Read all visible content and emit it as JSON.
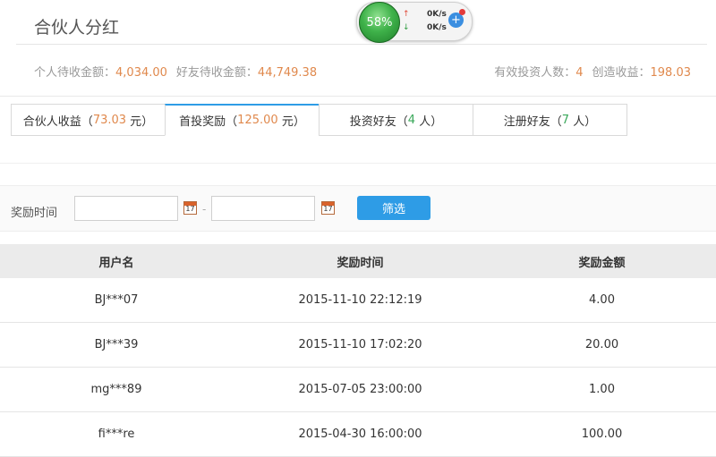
{
  "page": {
    "title": "合伙人分红"
  },
  "summary": {
    "pending_label": "个人待收金额：",
    "pending_value": "4,034.00",
    "friends_pending_label": "好友待收金额：",
    "friends_pending_value": "44,749.38",
    "investors_label": "有效投资人数：",
    "investors_value": "4",
    "created_label": "创造收益：",
    "created_value": "198.03"
  },
  "tabs": [
    {
      "label": "合伙人收益",
      "open": "（",
      "value": "73.03",
      "unit": "元",
      "close": "）"
    },
    {
      "label": "首投奖励",
      "open": "（",
      "value": "125.00",
      "unit": "元",
      "close": "）"
    },
    {
      "label": "投资好友",
      "open": "（",
      "value": "4",
      "unit": "人",
      "close": "）"
    },
    {
      "label": "注册好友",
      "open": "（",
      "value": "7",
      "unit": "人",
      "close": "）"
    }
  ],
  "filter": {
    "label": "奖励时间",
    "separator": "-",
    "button": "筛选",
    "start_value": "",
    "end_value": "",
    "calendar_glyph": "17"
  },
  "table": {
    "headers": [
      "用户名",
      "奖励时间",
      "奖励金额"
    ],
    "rows": [
      [
        "BJ***07",
        "2015-11-10 22:12:19",
        "4.00"
      ],
      [
        "BJ***39",
        "2015-11-10 17:02:20",
        "20.00"
      ],
      [
        "mg***89",
        "2015-07-05 23:00:00",
        "1.00"
      ],
      [
        "fi***re",
        "2015-04-30 16:00:00",
        "100.00"
      ]
    ]
  },
  "widget": {
    "percent": "58%",
    "up_speed": "0K/s",
    "down_speed": "0K/s",
    "up_arrow": "↑",
    "down_arrow": "↓",
    "plus": "+"
  },
  "colors": {
    "accent_blue": "#2e9ce6",
    "value_orange": "#e0894d",
    "value_green": "#3aa85a"
  }
}
